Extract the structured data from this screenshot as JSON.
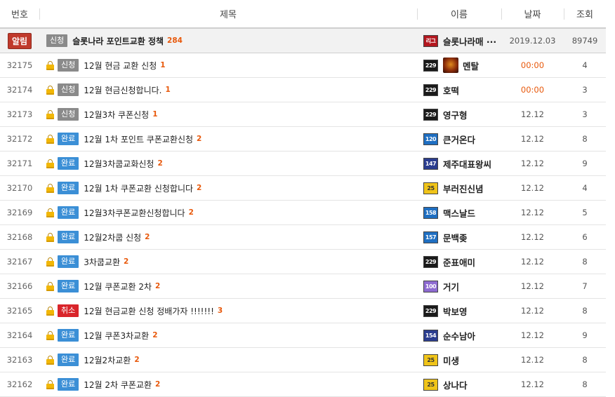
{
  "header": {
    "no": "번호",
    "title": "제목",
    "name": "이름",
    "date": "날짜",
    "views": "조회"
  },
  "notice": {
    "badge": "알림",
    "tag": "신청",
    "subject": "슬롯나라 포인트교환 정책",
    "count": "284",
    "level": "리그",
    "name": "슬롯나라매 ···",
    "date": "2019.12.03",
    "views": "89749"
  },
  "rows": [
    {
      "no": "32175",
      "tag": "신청",
      "tag_color": "gray",
      "subject": "12월 현금 교환 신청",
      "count": "1",
      "level": "229",
      "level_color": "black",
      "avatar": true,
      "name": "멘탈",
      "date": "00:00",
      "date_orange": true,
      "views": "4"
    },
    {
      "no": "32174",
      "tag": "신청",
      "tag_color": "gray",
      "subject": "12월 현금신청합니다.",
      "count": "1",
      "level": "229",
      "level_color": "black",
      "name": "호떡",
      "date": "00:00",
      "date_orange": true,
      "views": "3"
    },
    {
      "no": "32173",
      "tag": "신청",
      "tag_color": "gray",
      "subject": "12월3차 쿠폰신청",
      "count": "1",
      "level": "229",
      "level_color": "black",
      "name": "영구형",
      "date": "12.12",
      "views": "3"
    },
    {
      "no": "32172",
      "tag": "완료",
      "tag_color": "blue",
      "subject": "12월 1차 포인트 쿠폰교환신청",
      "count": "2",
      "level": "120",
      "level_color": "blue",
      "name": "큰거온다",
      "date": "12.12",
      "views": "8"
    },
    {
      "no": "32171",
      "tag": "완료",
      "tag_color": "blue",
      "subject": "12월3차쿱교화신청",
      "count": "2",
      "level": "147",
      "level_color": "navy",
      "name": "제주대표왕씨",
      "date": "12.12",
      "views": "9"
    },
    {
      "no": "32170",
      "tag": "완료",
      "tag_color": "blue",
      "subject": "12월 1차 쿠폰교환 신청합니다",
      "count": "2",
      "level": "25",
      "level_color": "gold",
      "name": "부러진신념",
      "date": "12.12",
      "views": "4"
    },
    {
      "no": "32169",
      "tag": "완료",
      "tag_color": "blue",
      "subject": "12월3차쿠폰교환신청합니다",
      "count": "2",
      "level": "158",
      "level_color": "blue",
      "name": "맥스날드",
      "date": "12.12",
      "views": "5"
    },
    {
      "no": "32168",
      "tag": "완료",
      "tag_color": "blue",
      "subject": "12월2차쿱 신청",
      "count": "2",
      "level": "157",
      "level_color": "blue",
      "name": "문백좆",
      "date": "12.12",
      "views": "6"
    },
    {
      "no": "32167",
      "tag": "완료",
      "tag_color": "blue",
      "subject": "3차쿱교환",
      "count": "2",
      "level": "229",
      "level_color": "black",
      "name": "준표애미",
      "date": "12.12",
      "views": "8"
    },
    {
      "no": "32166",
      "tag": "완료",
      "tag_color": "blue",
      "subject": "12월 쿠폰교환 2차",
      "count": "2",
      "level": "100",
      "level_color": "purple",
      "name": "거기",
      "date": "12.12",
      "views": "7"
    },
    {
      "no": "32165",
      "tag": "취소",
      "tag_color": "red",
      "subject": "12월 현금교환 신청 정배가자 !!!!!!!",
      "count": "3",
      "level": "229",
      "level_color": "black",
      "name": "박보영",
      "date": "12.12",
      "views": "8"
    },
    {
      "no": "32164",
      "tag": "완료",
      "tag_color": "blue",
      "subject": "12월 쿠폰3차교환",
      "count": "2",
      "level": "154",
      "level_color": "navy",
      "name": "순수남아",
      "date": "12.12",
      "views": "9"
    },
    {
      "no": "32163",
      "tag": "완료",
      "tag_color": "blue",
      "subject": "12월2차교환",
      "count": "2",
      "level": "25",
      "level_color": "gold",
      "name": "미생",
      "date": "12.12",
      "views": "8"
    },
    {
      "no": "32162",
      "tag": "완료",
      "tag_color": "blue",
      "subject": "12월 2차 쿠폰교환",
      "count": "2",
      "level": "25",
      "level_color": "gold",
      "name": "상나다",
      "date": "12.12",
      "views": "8"
    }
  ],
  "icons": {
    "lock": "lock-icon",
    "level": "level-badge-icon",
    "avatar": "avatar-icon"
  }
}
